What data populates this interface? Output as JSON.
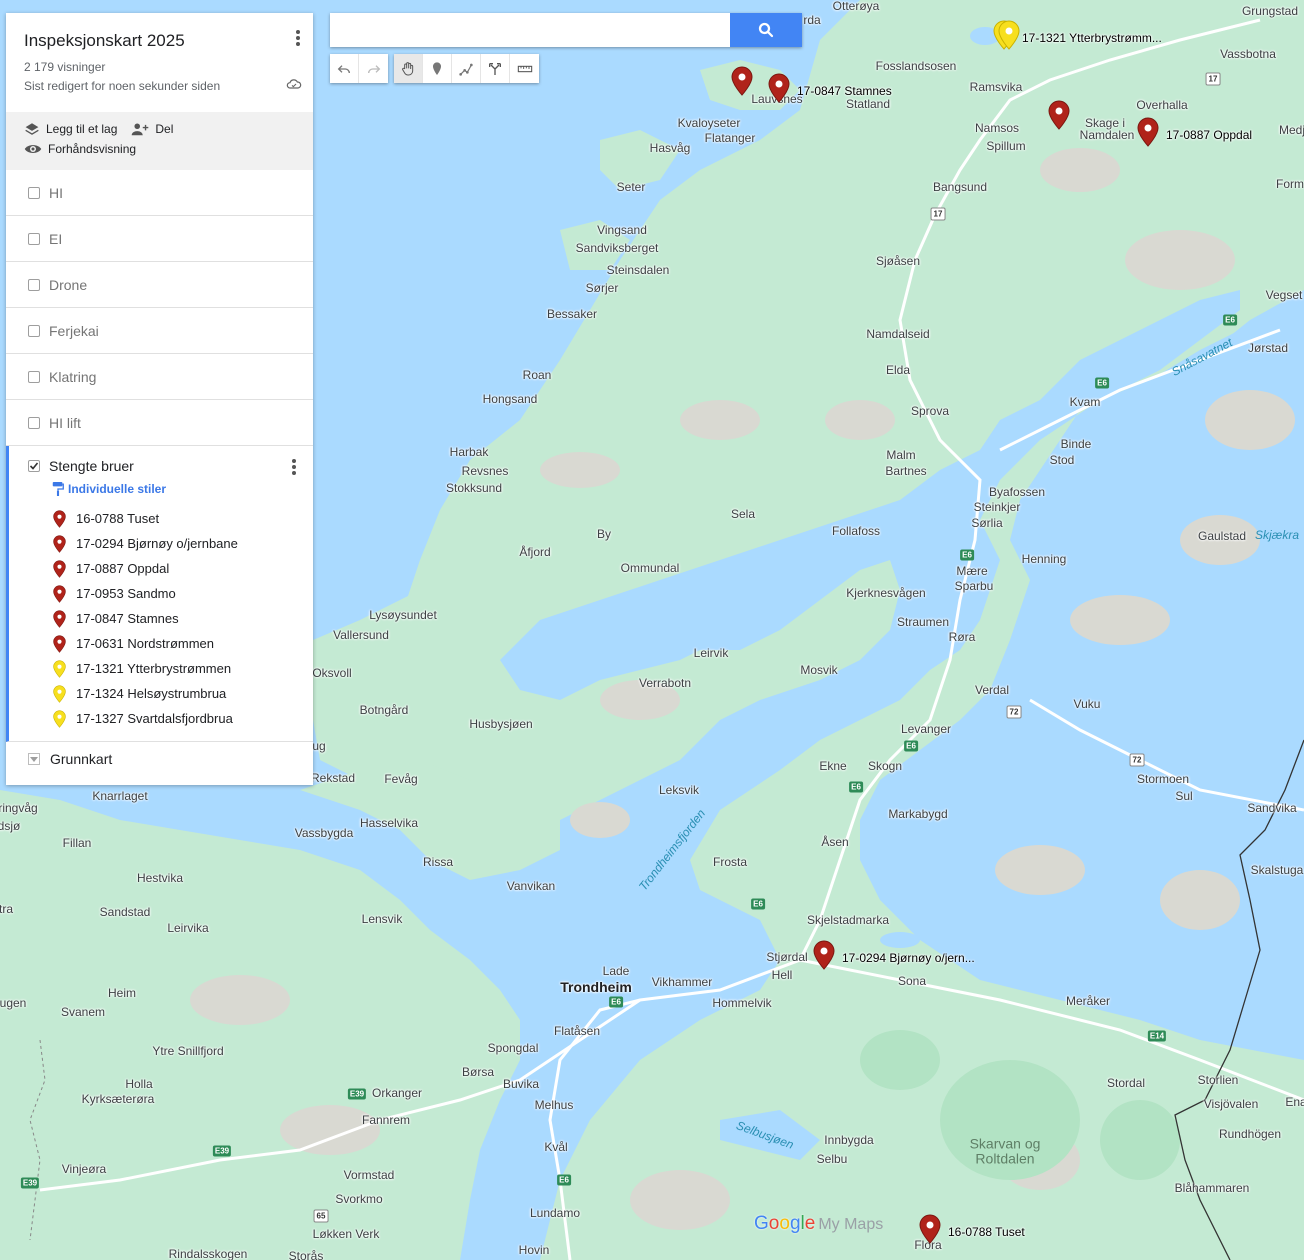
{
  "search": {
    "placeholder": "",
    "value": ""
  },
  "panel": {
    "title": "Inspeksjonskart 2025",
    "views": "2 179 visninger",
    "last_edited": "Sist redigert for noen sekunder siden",
    "actions": {
      "add_layer": "Legg til et lag",
      "share": "Del",
      "preview": "Forhåndsvisning"
    },
    "layers": [
      {
        "name": "HI",
        "checked": false
      },
      {
        "name": "EI",
        "checked": false
      },
      {
        "name": "Drone",
        "checked": false
      },
      {
        "name": "Ferjekai",
        "checked": false
      },
      {
        "name": "Klatring",
        "checked": false
      },
      {
        "name": "HI lift",
        "checked": false
      }
    ],
    "active_layer": {
      "name": "Stengte bruer",
      "checked": true,
      "style_link": "Individuelle stiler",
      "features": [
        {
          "label": "16-0788 Tuset",
          "color": "#b0231a"
        },
        {
          "label": "17-0294 Bjørnøy o/jernbane",
          "color": "#b0231a"
        },
        {
          "label": "17-0887 Oppdal",
          "color": "#b0231a"
        },
        {
          "label": "17-0953 Sandmo",
          "color": "#b0231a"
        },
        {
          "label": "17-0847 Stamnes",
          "color": "#b0231a"
        },
        {
          "label": "17-0631 Nordstrømmen",
          "color": "#b0231a"
        },
        {
          "label": "17-1321 Ytterbrystrømmen",
          "color": "#f7df1e"
        },
        {
          "label": "17-1324 Helsøystrumbrua",
          "color": "#f7df1e"
        },
        {
          "label": "17-1327 Svartdalsfjordbrua",
          "color": "#f7df1e"
        }
      ]
    },
    "basemap": "Grunnkart"
  },
  "map": {
    "colors": {
      "water": "#aadaff",
      "land": "#c4ead3",
      "forest": "#b2e3c4",
      "highland": "#d9d9d2",
      "road": "#ffffff",
      "red_marker": "#b0231a",
      "yellow_marker": "#f7df1e"
    },
    "markers": [
      {
        "id": "stamnes-a",
        "color": "#b0231a",
        "label": ""
      },
      {
        "id": "stamnes-b",
        "color": "#b0231a",
        "label": "17-0847 Stamnes"
      },
      {
        "id": "ytterbry",
        "color": "#f7df1e",
        "label": "17-1321 Ytterbrystrømm..."
      },
      {
        "id": "skage",
        "color": "#b0231a",
        "label": ""
      },
      {
        "id": "oppdal",
        "color": "#b0231a",
        "label": "17-0887 Oppdal"
      },
      {
        "id": "bjornoy",
        "color": "#b0231a",
        "label": "17-0294 Bjørnøy o/jern..."
      },
      {
        "id": "tuset",
        "color": "#b0231a",
        "label": "16-0788 Tuset"
      }
    ],
    "places": [
      "Otterøya",
      "Grungstad",
      "Vassbotna",
      "Fosslandsosen",
      "Ramsvika",
      "Overhalla",
      "Skage i",
      "Namdalen",
      "Namsos",
      "Spillum",
      "Medj",
      "Form",
      "Lauvsnes",
      "Statland",
      "Kvaloyseter",
      "Flatanger",
      "Hasvåg",
      "Seter",
      "Bangsund",
      "Vingsand",
      "Sandviksberget",
      "Steinsdalen",
      "Sørjer",
      "Bessaker",
      "Sjøåsen",
      "Vegset",
      "Namdalseid",
      "Jørstad",
      "Roan",
      "Elda",
      "Kvam",
      "Hongsand",
      "Sprova",
      "Binde",
      "Stod",
      "Harbak",
      "Revsnes",
      "Stokksund",
      "Malm",
      "Bartnes",
      "Byafossen",
      "Steinkjer",
      "Sørlia",
      "Sela",
      "By",
      "Follafoss",
      "Gaulstad",
      "Henning",
      "Åfjord",
      "Ommundal",
      "Mære",
      "Sparbu",
      "Kjerknesvågen",
      "Lysøysundet",
      "Vallersund",
      "Straumen",
      "Røra",
      "Leirvik",
      "Oksvoll",
      "Mosvik",
      "Verrabotn",
      "Verdal",
      "Botngård",
      "Vuku",
      "Husbysjøen",
      "Levanger",
      "Ekne",
      "Skogn",
      "Stormoen",
      "Sul",
      "Rekstad",
      "Fevåg",
      "Leksvik",
      "Knarrlaget",
      "Markabygd",
      "Sandvika",
      "Vassbygda",
      "Hasselvika",
      "Skalstuga",
      "Fillan",
      "Åsen",
      "Rissa",
      "Frosta",
      "Hestvika",
      "Vanvikan",
      "Sandstad",
      "Lensvik",
      "Skjelstadmarka",
      "Leirvika",
      "Stjørdal",
      "Hell",
      "Lade",
      "Trondheim",
      "Vikhammer",
      "Sona",
      "Meråker",
      "Heim",
      "Hommelvik",
      "Svanem",
      "Flatåsen",
      "Spongdal",
      "Ytre Snillfjord",
      "Børsa",
      "Buvika",
      "Stordal",
      "Storlien",
      "Holla",
      "Orkanger",
      "Visjövalen",
      "Kyrksæterøra",
      "Melhus",
      "Fannrem",
      "Innbygda",
      "Rundhögen",
      "Vinjeøra",
      "Kvål",
      "Selbu",
      "Vormstad",
      "Svorkmo",
      "Blåhammaren",
      "Lundamo",
      "Løkken Verk",
      "Flora",
      "Rindalsskogen",
      "Hovin",
      "Storås",
      "Ena",
      "ringvåg",
      "dsjø",
      "tra",
      "ugen",
      "ug",
      "rda"
    ],
    "water_labels": [
      "Snåsavatnet",
      "Trondheimsfjorden",
      "Selbusjøen",
      "Skjækra"
    ],
    "regions": [
      "Skarvan og Roltdalen"
    ],
    "shields": [
      "17",
      "17",
      "E6",
      "E6",
      "E6",
      "72",
      "E6",
      "72",
      "E6",
      "E6",
      "E6",
      "E39",
      "E39",
      "E39",
      "E6",
      "E14",
      "65"
    ]
  },
  "logo": {
    "google": "Google",
    "product": "My Maps"
  }
}
